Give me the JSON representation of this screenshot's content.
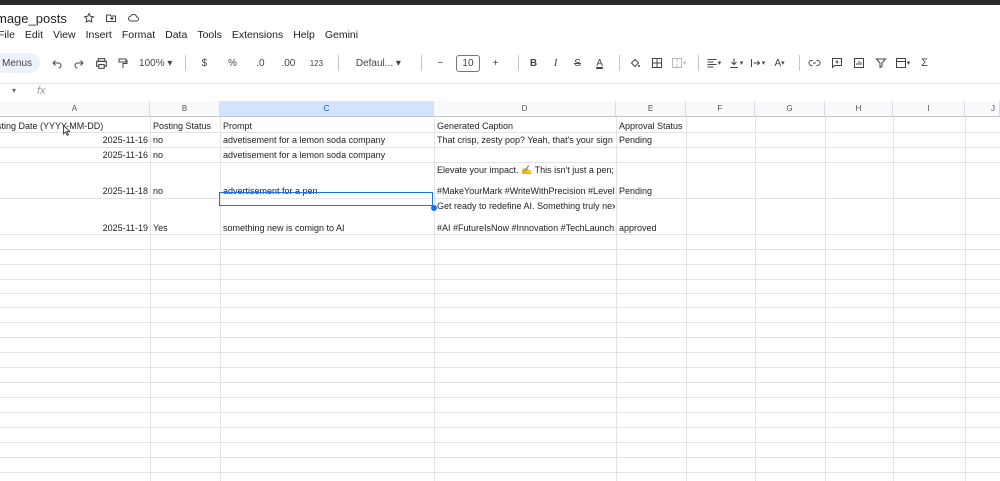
{
  "doc": {
    "title": "mage_posts"
  },
  "menu": [
    "File",
    "Edit",
    "View",
    "Insert",
    "Format",
    "Data",
    "Tools",
    "Extensions",
    "Help",
    "Gemini"
  ],
  "toolbar": {
    "menus": "Menus",
    "zoom": "100%",
    "currency": "$",
    "percent": "%",
    "dec_decrease": ".0",
    "dec_increase": ".00",
    "number_format": "123",
    "font": "Defaul...",
    "font_size": "10",
    "minus": "−",
    "plus": "+"
  },
  "formula": {
    "fx": "fx"
  },
  "columns": [
    "A",
    "B",
    "C",
    "D",
    "E",
    "F",
    "G",
    "H",
    "I",
    "J"
  ],
  "rows": {
    "header": {
      "a": "sting Date (YYYY-MM-DD)",
      "b": "Posting Status",
      "c": "Prompt",
      "d": "Generated Caption",
      "e": "Approval Status"
    },
    "r1": {
      "a": "2025-11-16",
      "b": "no",
      "c": "advetisement for a lemon soda company",
      "d": "That crisp, zesty pop? Yeah, that's your sign",
      "e": "Pending"
    },
    "r2": {
      "a": "2025-11-16",
      "b": "no",
      "c": "advetisement for a lemon soda company"
    },
    "r3": {
      "d1": "Elevate your impact. ✍️ This isn't just a pen;",
      "a": "2025-11-18",
      "b": "no",
      "c": "advertisement for a pen",
      "d2": "#MakeYourMark #WriteWithPrecision #LevelU",
      "e": "Pending"
    },
    "r4": {
      "d1": "Get ready to redefine AI. Something truly nex",
      "a": "2025-11-19",
      "b": "Yes",
      "c": "something new is comign to AI",
      "d2": "#AI #FutureIsNow #Innovation #TechLaunch #",
      "e": "approved"
    }
  },
  "colors": {
    "accent": "#1a73e8",
    "selected_header": "#d3e3fd"
  }
}
